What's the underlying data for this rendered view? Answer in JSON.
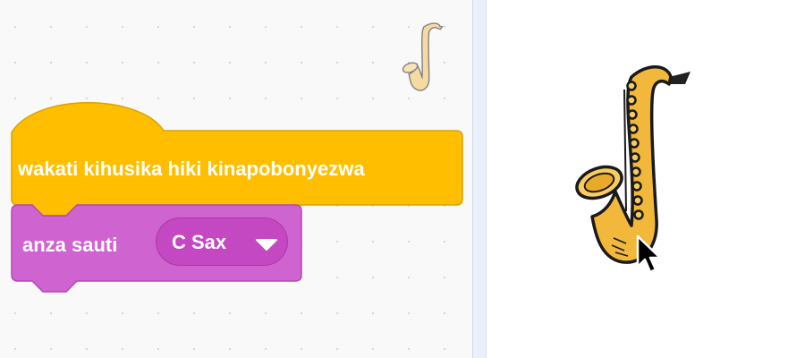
{
  "workspace": {
    "hat_block": {
      "label": "wakati kihusika hiki kinapobonyezwa",
      "color": "#ffbf00"
    },
    "sound_block": {
      "label": "anza sauti",
      "sound_value": "C Sax",
      "color": "#cf63cf",
      "dropdown_color": "#c348c2"
    }
  },
  "sprite_thumbnail": {
    "icon": "saxophone-icon"
  },
  "stage": {
    "sprite": {
      "icon": "saxophone-icon"
    }
  },
  "colors": {
    "workspace_bg": "#f9f9f9",
    "scrollbar": "#e9f1fc",
    "saxophone": "#f2b83b"
  }
}
